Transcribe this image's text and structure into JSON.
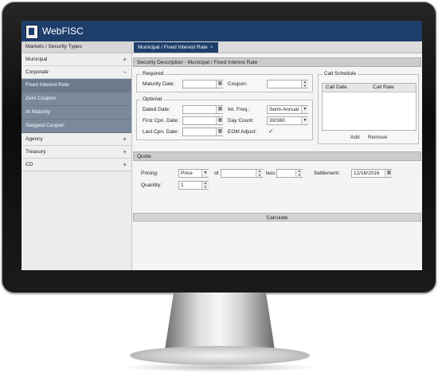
{
  "app": {
    "title": "WebFISC"
  },
  "sidebar": {
    "header": "Markets / Security Types",
    "items": [
      {
        "label": "Municipal",
        "sign": "+"
      },
      {
        "label": "Corporate",
        "sign": "−"
      }
    ],
    "corporate_children": [
      "Fixed Interest Rate",
      "Zero Coupon",
      "At Maturity",
      "Stepped Coupon"
    ],
    "items_after": [
      {
        "label": "Agency",
        "sign": "+"
      },
      {
        "label": "Treasury",
        "sign": "+"
      },
      {
        "label": "CD",
        "sign": "+"
      }
    ]
  },
  "tab": {
    "label": "Municipal / Fixed Interest Rate",
    "close": "×"
  },
  "security": {
    "section_title": "Security Description - Municipal / Fixed Interest Rate",
    "required": {
      "legend": "Required",
      "maturity_label": "Maturity Date:",
      "maturity_value": "",
      "coupon_label": "Coupon:",
      "coupon_value": ""
    },
    "optional": {
      "legend": "Optional",
      "dated_label": "Dated Date:",
      "first_cpn_label": "First Cpn. Date:",
      "last_cpn_label": "Last Cpn. Date:",
      "int_freq_label": "Int. Freq.:",
      "int_freq_value": "Semi-Annual",
      "day_count_label": "Day Count:",
      "day_count_value": "30/360",
      "eom_label": "EOM Adjust:",
      "eom_checked": "✓"
    },
    "call_schedule": {
      "legend": "Call Schedule",
      "columns": [
        "Call Date",
        "Call Rate"
      ],
      "add_label": "Add",
      "remove_label": "Remove"
    }
  },
  "quote": {
    "section_title": "Quote",
    "pricing_label": "Pricing:",
    "pricing_value": "Price",
    "of_label": "of",
    "less_label": "less",
    "settlement_label": "Settlement:",
    "settlement_value": "12/16/2016",
    "quantity_label": "Quantity:",
    "quantity_value": "1",
    "calculate_label": "Calculate"
  },
  "icons": {
    "calendar": "calendar-icon",
    "spinner": "spinner-arrows-icon",
    "dropdown": "chevron-down-icon"
  },
  "colors": {
    "brand": "#1e3f6c",
    "sidebar_selected": "#7a8a9a"
  }
}
